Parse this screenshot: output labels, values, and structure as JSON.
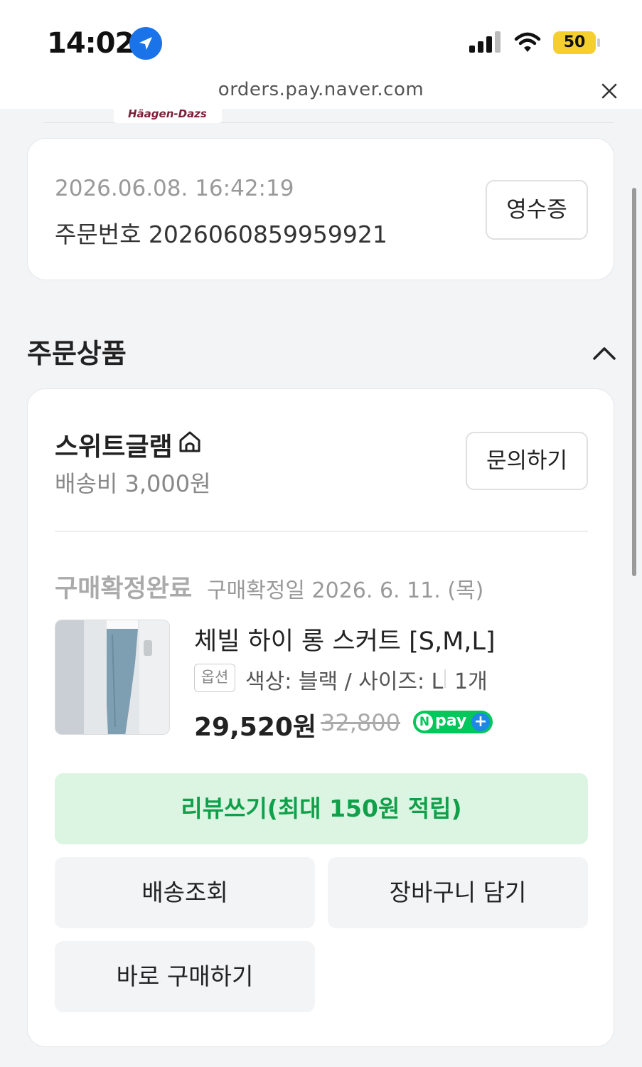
{
  "status_bar": {
    "time": "14:02",
    "battery": "50"
  },
  "browser": {
    "url": "orders.pay.naver.com"
  },
  "previous_item": {
    "brand_text": "Häagen-Dazs"
  },
  "order": {
    "datetime": "2026.06.08. 16:42:19",
    "number": "주문번호 2026060859959921",
    "receipt_label": "영수증"
  },
  "section": {
    "title": "주문상품"
  },
  "seller": {
    "name": "스위트글램",
    "shipping_fee": "배송비 3,000원",
    "inquiry_label": "문의하기"
  },
  "item": {
    "status": "구매확정완료",
    "confirm_date": "구매확정일 2026. 6. 11. (목)",
    "name": "체빌 하이 롱 스커트 [S,M,L]",
    "option_badge": "옵션",
    "option": "색상: 블랙 / 사이즈: L",
    "quantity": "1개",
    "sale_price": "29,520원",
    "original_price": "32,800",
    "npay_n": "N",
    "npay_text": "pay",
    "npay_plus": "+"
  },
  "actions": {
    "review": "리뷰쓰기(최대 150원 적립)",
    "tracking": "배송조회",
    "cart": "장바구니 담기",
    "buy_now": "바로 구매하기"
  },
  "colors": {
    "naver_green": "#03c75a",
    "review_bg": "#dcf5e3",
    "review_text": "#10a04a",
    "location_blue": "#1a73e8",
    "battery_yellow": "#f5cf2e"
  }
}
